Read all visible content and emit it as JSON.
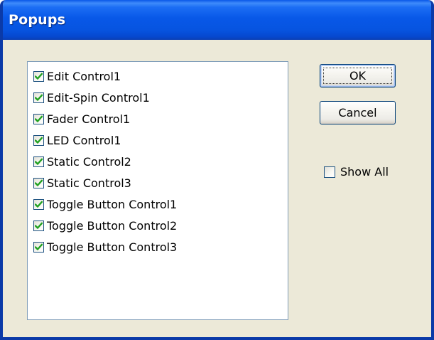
{
  "dialog": {
    "title": "Popups"
  },
  "list": {
    "items": [
      {
        "label": "Edit Control1",
        "checked": true
      },
      {
        "label": "Edit-Spin Control1",
        "checked": true
      },
      {
        "label": "Fader Control1",
        "checked": true
      },
      {
        "label": "LED Control1",
        "checked": true
      },
      {
        "label": "Static Control2",
        "checked": true
      },
      {
        "label": "Static Control3",
        "checked": true
      },
      {
        "label": "Toggle Button Control1",
        "checked": true
      },
      {
        "label": "Toggle Button Control2",
        "checked": true
      },
      {
        "label": "Toggle Button Control3",
        "checked": true
      }
    ]
  },
  "buttons": {
    "ok_label": "OK",
    "cancel_label": "Cancel"
  },
  "show_all": {
    "label": "Show All",
    "checked": false
  },
  "colors": {
    "titlebar": "#0858e8",
    "dialog_bg": "#ece9d8",
    "checkmark": "#21a121",
    "checkbox_border": "#1c5180"
  },
  "icons": {
    "checked_box": "checkmark-icon"
  }
}
